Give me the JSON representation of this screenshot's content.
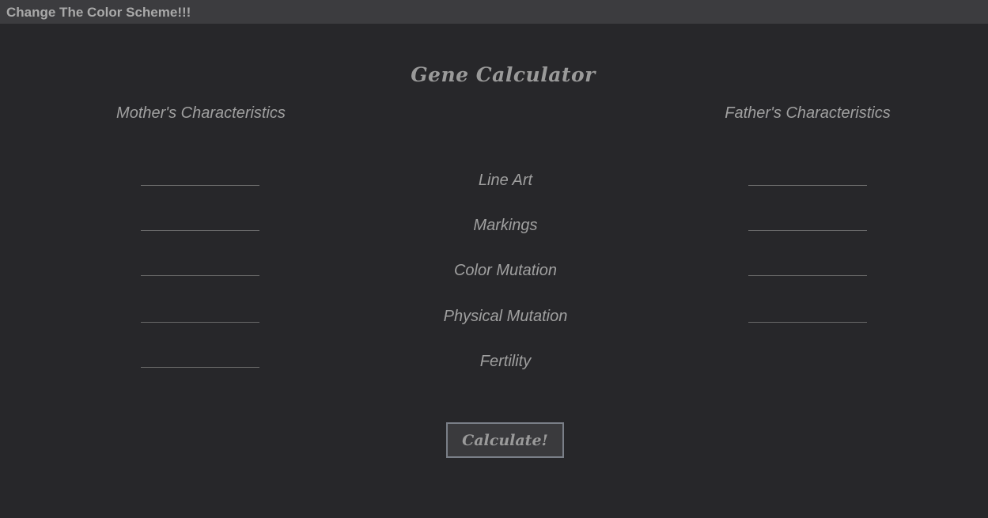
{
  "topbar": {
    "link_label": "Change The Color Scheme!!!"
  },
  "main": {
    "title": "Gene Calculator",
    "mother_heading": "Mother's Characteristics",
    "father_heading": "Father's Characteristics",
    "rows": [
      {
        "label": "Line Art",
        "mother_value": "",
        "father_value": ""
      },
      {
        "label": "Markings",
        "mother_value": "",
        "father_value": ""
      },
      {
        "label": "Color Mutation",
        "mother_value": "",
        "father_value": ""
      },
      {
        "label": "Physical Mutation",
        "mother_value": "",
        "father_value": ""
      },
      {
        "label": "Fertility",
        "mother_value": ""
      }
    ],
    "calculate_label": "Calculate!"
  },
  "colors": {
    "background": "#27272a",
    "topbar": "#3c3c3f",
    "text": "#a0a0a0",
    "button_border": "#7a7f88"
  }
}
